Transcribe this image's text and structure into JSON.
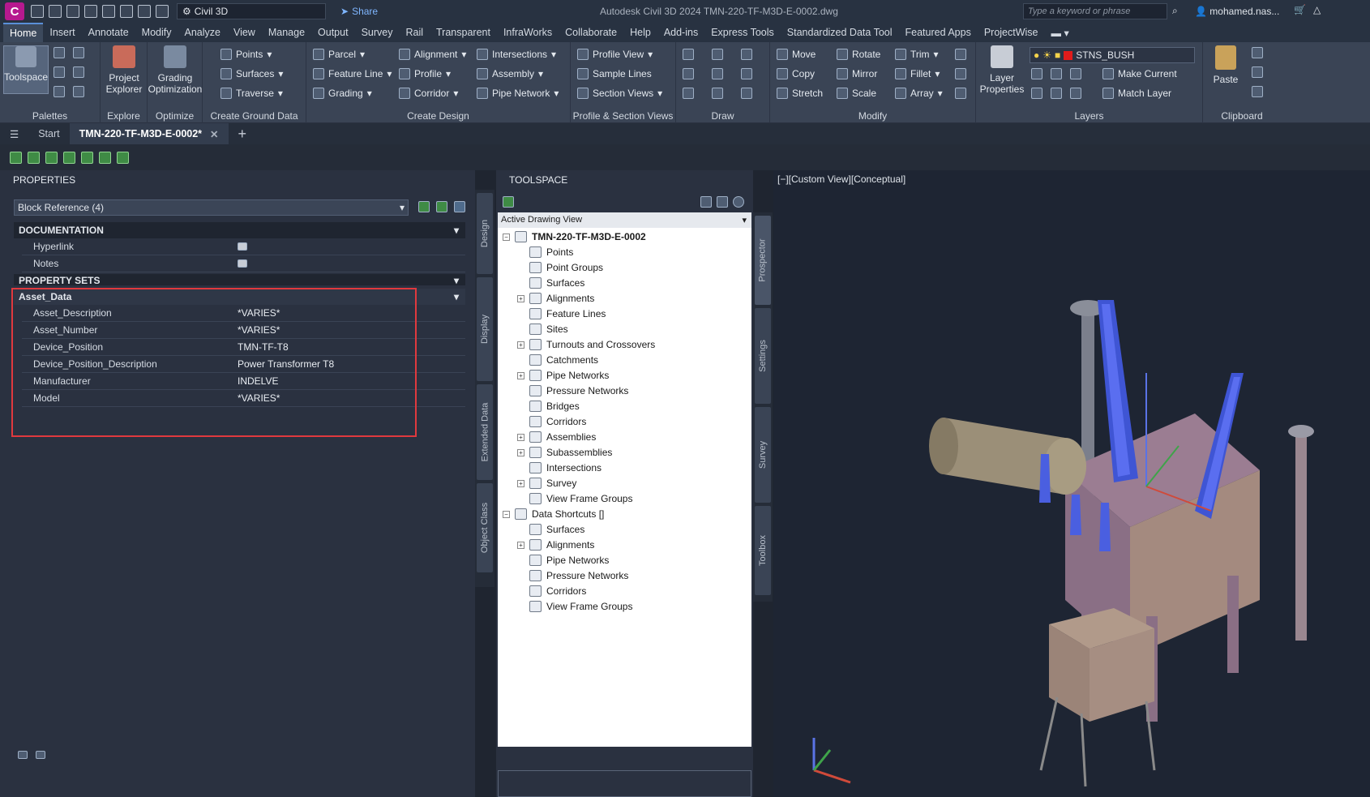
{
  "titlebar": {
    "logo": "C",
    "workspace": "Civil 3D",
    "share": "Share",
    "title": "Autodesk Civil 3D 2024    TMN-220-TF-M3D-E-0002.dwg",
    "search_placeholder": "Type a keyword or phrase",
    "user": "mohamed.nas..."
  },
  "menu": [
    "Home",
    "Insert",
    "Annotate",
    "Modify",
    "Analyze",
    "View",
    "Manage",
    "Output",
    "Survey",
    "Rail",
    "Transparent",
    "InfraWorks",
    "Collaborate",
    "Help",
    "Add-ins",
    "Express Tools",
    "Standardized Data Tool",
    "Featured Apps",
    "ProjectWise"
  ],
  "ribbon": {
    "toolspace": "Toolspace",
    "project_explorer": "Project Explorer",
    "grading_optimization": "Grading Optimization",
    "ground": [
      "Points",
      "Surfaces",
      "Traverse"
    ],
    "design1": [
      "Parcel",
      "Feature Line",
      "Grading"
    ],
    "design2": [
      "Alignment",
      "Profile",
      "Corridor"
    ],
    "design3": [
      "Intersections",
      "Assembly",
      "Pipe Network"
    ],
    "profile": [
      "Profile View",
      "Sample Lines",
      "Section Views"
    ],
    "modify1": [
      "Move",
      "Copy",
      "Stretch"
    ],
    "modify2": [
      "Rotate",
      "Mirror",
      "Scale"
    ],
    "modify3": [
      "Trim",
      "Fillet",
      "Array"
    ],
    "layer_properties": "Layer Properties",
    "layer_name": "STNS_BUSH",
    "make_current": "Make Current",
    "match_layer": "Match Layer",
    "paste": "Paste",
    "panel_titles": [
      "Palettes",
      "Explore",
      "Optimize",
      "Create Ground Data",
      "Create Design",
      "Profile & Section Views",
      "Draw",
      "Modify",
      "Layers",
      "Clipboard"
    ]
  },
  "doc_tabs": {
    "start": "Start",
    "active": "TMN-220-TF-M3D-E-0002*"
  },
  "properties": {
    "header": "PROPERTIES",
    "block_ref": "Block Reference (4)",
    "documentation": "DOCUMENTATION",
    "hyperlink": "Hyperlink",
    "notes": "Notes",
    "property_sets": "PROPERTY SETS",
    "asset_data": "Asset_Data",
    "rows": [
      {
        "name": "Asset_Description",
        "value": "*VARIES*"
      },
      {
        "name": "Asset_Number",
        "value": "*VARIES*"
      },
      {
        "name": "Device_Position",
        "value": "TMN-TF-T8"
      },
      {
        "name": "Device_Position_Description",
        "value": "Power Transformer T8"
      },
      {
        "name": "Manufacturer",
        "value": "INDELVE"
      },
      {
        "name": "Model",
        "value": "*VARIES*"
      }
    ],
    "side_tabs": [
      "Design",
      "Display",
      "Extended Data",
      "Object Class"
    ]
  },
  "toolspace": {
    "header": "TOOLSPACE",
    "view": "Active Drawing View",
    "root": "TMN-220-TF-M3D-E-0002",
    "items": [
      "Points",
      "Point Groups",
      "Surfaces",
      "Alignments",
      "Feature Lines",
      "Sites",
      "Turnouts and Crossovers",
      "Catchments",
      "Pipe Networks",
      "Pressure Networks",
      "Bridges",
      "Corridors",
      "Assemblies",
      "Subassemblies",
      "Intersections",
      "Survey",
      "View Frame Groups"
    ],
    "shortcuts_root": "Data Shortcuts []",
    "shortcuts": [
      "Surfaces",
      "Alignments",
      "Pipe Networks",
      "Pressure Networks",
      "Corridors",
      "View Frame Groups"
    ],
    "side_tabs": [
      "Prospector",
      "Settings",
      "Survey",
      "Toolbox"
    ]
  },
  "viewport": {
    "label": "[−][Custom View][Conceptual]"
  }
}
